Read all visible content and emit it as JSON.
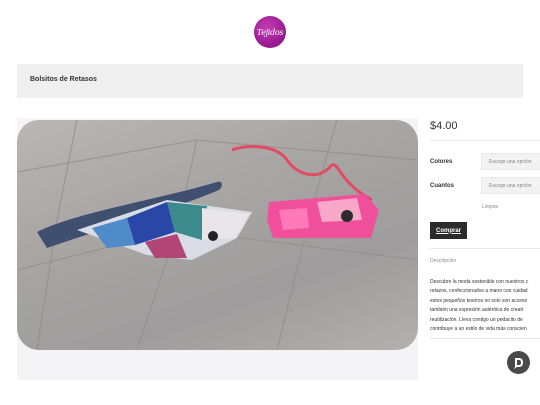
{
  "header": {
    "logo_text": "Tejidos"
  },
  "breadcrumb": {
    "title": "Bolsitos de Retasos"
  },
  "product": {
    "price": "$4.00",
    "variations": [
      {
        "label": "Colores",
        "placeholder": "Escoge una opción"
      },
      {
        "label": "Cuantos",
        "placeholder": "Escoge una opción"
      }
    ],
    "clear_label": "Limpiar",
    "buy_label": "Comprar",
    "description_title": "Descripción",
    "description_lines": [
      "Descubre la moda sostenible con nuestros c",
      "retazos, confeccionados a mano con cuidad",
      "estos pequeños tesoros no solo son acceso",
      "también una expresión auténtica de creatr",
      "reutilización. Lleva contigo un pedacito de",
      "contribuye a un estilo de vida más conscien"
    ]
  },
  "colors": {
    "accent": "#9c1e93",
    "button": "#2b2b2b",
    "bar": "#efefef"
  },
  "icons": {
    "chat": "chat-bubble-icon"
  }
}
